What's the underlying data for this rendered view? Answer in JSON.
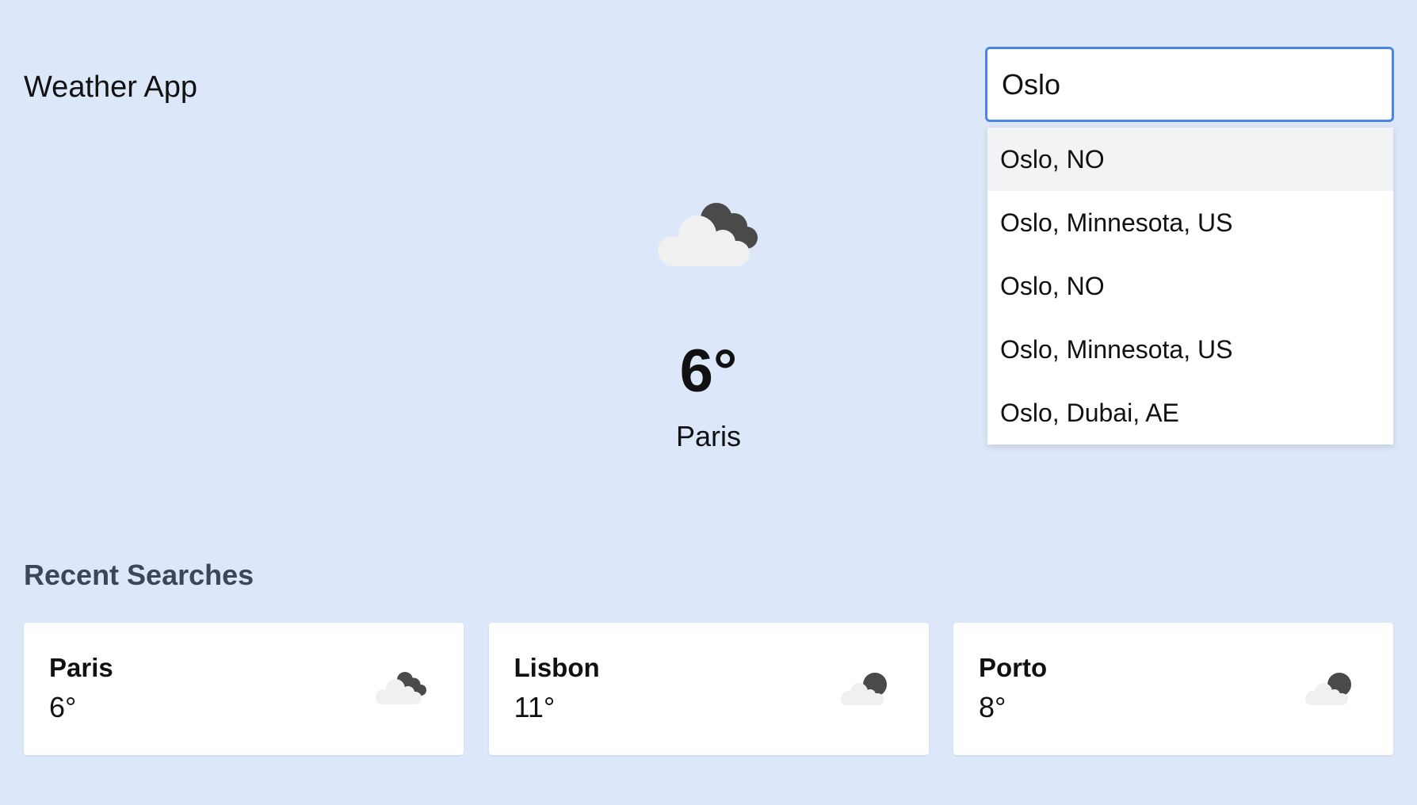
{
  "header": {
    "title": "Weather App"
  },
  "search": {
    "value": "Oslo",
    "suggestions": [
      "Oslo, NO",
      "Oslo, Minnesota, US",
      "Oslo, NO",
      "Oslo, Minnesota, US",
      "Oslo, Dubai, AE"
    ]
  },
  "current": {
    "temp": "6°",
    "city": "Paris",
    "icon": "cloudy-icon"
  },
  "recent": {
    "heading": "Recent Searches",
    "items": [
      {
        "city": "Paris",
        "temp": "6°",
        "icon": "cloudy-icon"
      },
      {
        "city": "Lisbon",
        "temp": "11°",
        "icon": "partly-cloudy-night-icon"
      },
      {
        "city": "Porto",
        "temp": "8°",
        "icon": "partly-cloudy-night-icon"
      }
    ]
  },
  "colors": {
    "background": "#dce8fa",
    "accent": "#4a86e8",
    "cloud_light": "#f0f0f0",
    "cloud_dark": "#4a4a4a"
  }
}
